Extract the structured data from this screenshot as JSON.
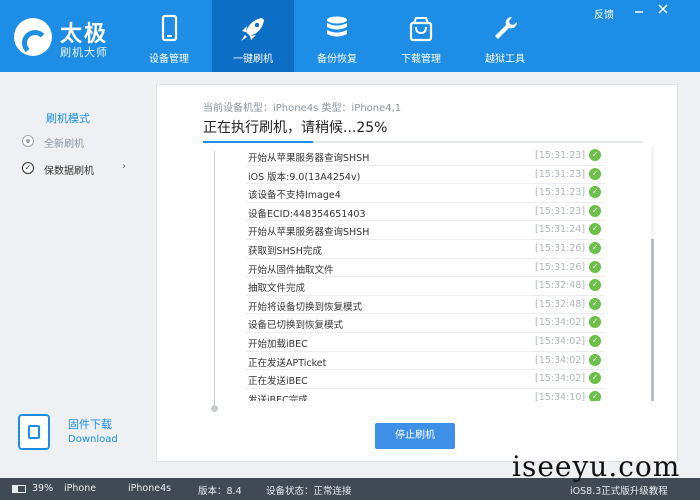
{
  "app": {
    "logo_title": "太极",
    "logo_subtitle": "刷机大师"
  },
  "nav": {
    "items": [
      {
        "label": "设备管理",
        "icon": "phone-icon",
        "active": false
      },
      {
        "label": "一键刷机",
        "icon": "rocket-icon",
        "active": true
      },
      {
        "label": "备份恢复",
        "icon": "database-icon",
        "active": false
      },
      {
        "label": "下载管理",
        "icon": "shopping-bag-icon",
        "active": false
      },
      {
        "label": "越狱工具",
        "icon": "wrench-icon",
        "active": false
      }
    ],
    "feedback_label": "反馈"
  },
  "sidebar": {
    "title": "刷机模式",
    "items": [
      {
        "label": "全新刷机",
        "selected": false
      },
      {
        "label": "保数据刷机",
        "selected": true
      }
    ],
    "download": {
      "title": "固件下载",
      "subtitle": "Download"
    }
  },
  "main": {
    "device_info": "当前设备机型：iPhone4s 类型：iPhone4,1",
    "status": "正在执行刷机，请稍候...25%",
    "progress": 0.25,
    "log": [
      {
        "text": "开始从苹果服务器查询SHSH",
        "time": "[15:31:23]"
      },
      {
        "text": "iOS 版本:9.0(13A4254v)",
        "time": "[15:31:23]"
      },
      {
        "text": "该设备不支持Image4",
        "time": "[15:31:23]"
      },
      {
        "text": "设备ECID:448354651403",
        "time": "[15:31:23]"
      },
      {
        "text": "开始从苹果服务器查询SHSH",
        "time": "[15:31:24]"
      },
      {
        "text": "获取到SHSH完成",
        "time": "[15:31:26]"
      },
      {
        "text": "开始从固件抽取文件",
        "time": "[15:31:26]"
      },
      {
        "text": "抽取文件完成",
        "time": "[15:32:48]"
      },
      {
        "text": "开始将设备切换到恢复模式",
        "time": "[15:32:48]"
      },
      {
        "text": "设备已切换到恢复模式",
        "time": "[15:34:02]"
      },
      {
        "text": "开始加载iBEC",
        "time": "[15:34:02]"
      },
      {
        "text": "正在发送APTicket",
        "time": "[15:34:02]"
      },
      {
        "text": "正在发送iBEC",
        "time": "[15:34:02]"
      },
      {
        "text": "发送iBEC完成",
        "time": "[15:34:10]"
      }
    ],
    "stop_label": "停止刷机"
  },
  "statusbar": {
    "battery": "39%",
    "battery_level": 0.39,
    "device": "iPhone",
    "model": "iPhone4s",
    "version": "版本：8.4",
    "state": "设备状态：正常连接",
    "upgrade": "iOS8.3正式版升级教程"
  },
  "watermark": "iseeyu.com",
  "colors": {
    "header": "#1d8de6",
    "nav_active": "#0c6fc5",
    "accent": "#1d8de6",
    "success": "#6cc04a",
    "statusbar": "#3f4a55"
  }
}
